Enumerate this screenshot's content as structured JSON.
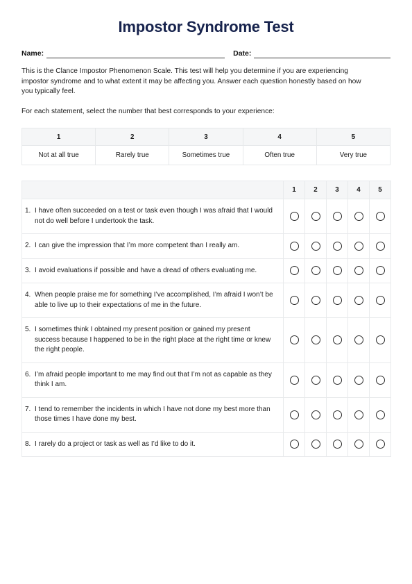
{
  "document": {
    "title": "Impostor Syndrome Test",
    "fields": [
      {
        "label": "Name:"
      },
      {
        "label": "Date:"
      }
    ],
    "intro_paragraph": "This is the Clance Impostor Phenomenon Scale. This test will help you determine if you are experiencing impostor syndrome and to what extent it may be affecting you. Answer each question honestly based on how you typically feel.",
    "instruction": "For each statement, select the number that best corresponds to your experience:"
  },
  "scale": {
    "numbers": [
      "1",
      "2",
      "3",
      "4",
      "5"
    ],
    "labels": [
      "Not at all true",
      "Rarely true",
      "Sometimes true",
      "Often true",
      "Very true"
    ]
  },
  "questions_table": {
    "header_blank": "",
    "option_headers": [
      "1",
      "2",
      "3",
      "4",
      "5"
    ],
    "rows": [
      {
        "number": "1.",
        "text": "I have often succeeded on a test or task even though I was afraid that I would not do well before I undertook the task."
      },
      {
        "number": "2.",
        "text": "I can give the impression that I’m more competent than I really am."
      },
      {
        "number": "3.",
        "text": "I avoid evaluations if possible and have a dread of others evaluating me."
      },
      {
        "number": "4.",
        "text": "When people praise me for something I’ve accomplished, I’m afraid I won’t be able to live up to their expectations of me in the future."
      },
      {
        "number": "5.",
        "text": "I sometimes think I obtained my present position or gained my present success because I happened to be in the right place at the right time or knew the right people."
      },
      {
        "number": "6.",
        "text": "I’m afraid people important to me may find out that I’m not as capable as they think I am."
      },
      {
        "number": "7.",
        "text": "I tend to remember the incidents in which I have not done my best more than those times I have done my best."
      },
      {
        "number": "8.",
        "text": "I rarely do a project or task as well as I’d like to do it."
      }
    ]
  },
  "colors": {
    "title": "#17234d",
    "header_background": "#f5f6f7",
    "border": "#e8eaec",
    "text": "#1b1b1b"
  }
}
